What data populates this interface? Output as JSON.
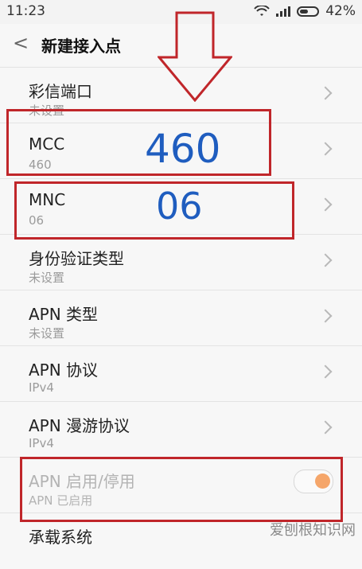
{
  "status": {
    "time": "11:23",
    "battery": "42%"
  },
  "header": {
    "title": "新建接入点"
  },
  "rows": [
    {
      "label": "彩信端口",
      "value": "未设置"
    },
    {
      "label": "MCC",
      "value": "460"
    },
    {
      "label": "MNC",
      "value": "06"
    },
    {
      "label": "身份验证类型",
      "value": "未设置"
    },
    {
      "label": "APN 类型",
      "value": "未设置"
    },
    {
      "label": "APN 协议",
      "value": "IPv4"
    },
    {
      "label": "APN 漫游协议",
      "value": "IPv4"
    },
    {
      "label": "APN 启用/停用",
      "value": "APN 已启用"
    },
    {
      "label": "承载系统",
      "value": ""
    }
  ],
  "annotations": {
    "mcc_big": "460",
    "mnc_big": "06",
    "colors": {
      "highlight_red": "#c0262a",
      "annotation_blue": "#1f5dbf",
      "toggle_orange": "#f5a66a"
    }
  },
  "watermark": "爱刨根知识网"
}
